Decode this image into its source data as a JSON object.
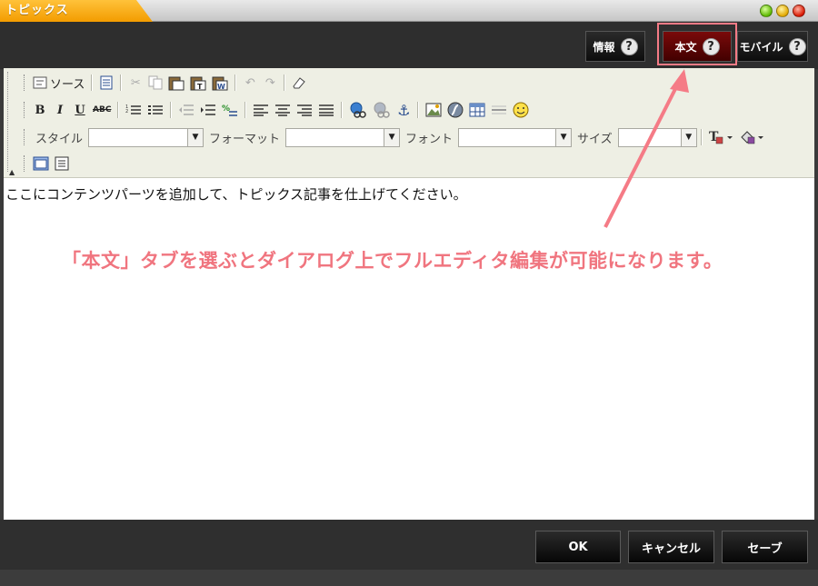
{
  "window": {
    "title": "トピックス"
  },
  "tabs": [
    {
      "label": "情報",
      "help": "?"
    },
    {
      "label": "本文",
      "help": "?",
      "active": true
    },
    {
      "label": "モバイル",
      "help": "?"
    }
  ],
  "toolbar": {
    "source_label": "ソース",
    "style_label": "スタイル",
    "format_label": "フォーマット",
    "font_label": "フォント",
    "size_label": "サイズ",
    "style_value": "",
    "format_value": "",
    "font_value": "",
    "size_value": "",
    "combo_arrow": "▼",
    "bold": "B",
    "italic": "I",
    "underline": "U",
    "strike": "ABC"
  },
  "editor": {
    "content": "ここにコンテンツパーツを追加して、トピックス記事を仕上げてください。"
  },
  "annotation": {
    "text": "「本文」タブを選ぶとダイアログ上でフルエディタ編集が可能になります。"
  },
  "footer": {
    "ok": "OK",
    "cancel": "キャンセル",
    "save": "セーブ"
  },
  "colors": {
    "title_tab": "#f5a100",
    "active_tab": "#6a0505",
    "annotation": "#f0757f"
  }
}
